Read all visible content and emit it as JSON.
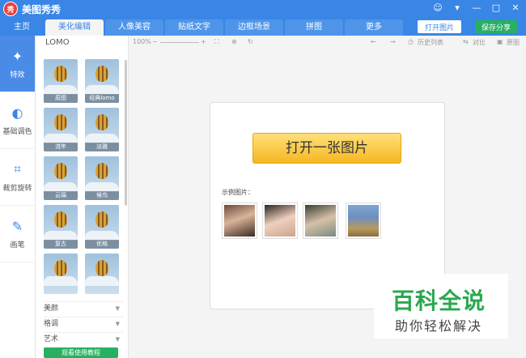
{
  "app": {
    "title": "美图秀秀",
    "logo_text": "秀"
  },
  "window_controls": [
    "☺",
    "▾",
    "—",
    "□",
    "✕"
  ],
  "tabs": [
    {
      "label": "主页"
    },
    {
      "label": "美化编辑"
    },
    {
      "label": "人像美容"
    },
    {
      "label": "贴纸文字"
    },
    {
      "label": "边框场景"
    },
    {
      "label": "拼图"
    },
    {
      "label": "更多"
    }
  ],
  "header_buttons": {
    "open": "打开图片",
    "save": "保存分享"
  },
  "tools": [
    {
      "label": "特效",
      "icon": "magic-wand-icon",
      "glyph": "✦"
    },
    {
      "label": "基础调色",
      "icon": "palette-icon",
      "glyph": "◐"
    },
    {
      "label": "裁剪旋转",
      "icon": "crop-icon",
      "glyph": "⌗"
    },
    {
      "label": "画笔",
      "icon": "brush-icon",
      "glyph": "✎"
    }
  ],
  "effects_panel": {
    "title": "LOMO",
    "thumbnails": [
      {
        "label": "原图"
      },
      {
        "label": "经典lomo"
      },
      {
        "label": "流年"
      },
      {
        "label": "淡雅"
      },
      {
        "label": "云端"
      },
      {
        "label": "候鸟"
      },
      {
        "label": "复古"
      },
      {
        "label": "优格"
      },
      {
        "label": ""
      },
      {
        "label": ""
      }
    ],
    "categories": [
      "美颜",
      "格调",
      "艺术"
    ],
    "tutorial_button": "观看使用教程"
  },
  "edit_toolbar": {
    "zoom": "100%",
    "minus": "−",
    "plus": "+",
    "history": "历史列表",
    "compare": "对比",
    "original": "原图"
  },
  "canvas": {
    "open_button": "打开一张图片",
    "sample_label": "示例图片："
  },
  "watermark": {
    "title": "百科全说",
    "subtitle": "助你轻松解决"
  }
}
